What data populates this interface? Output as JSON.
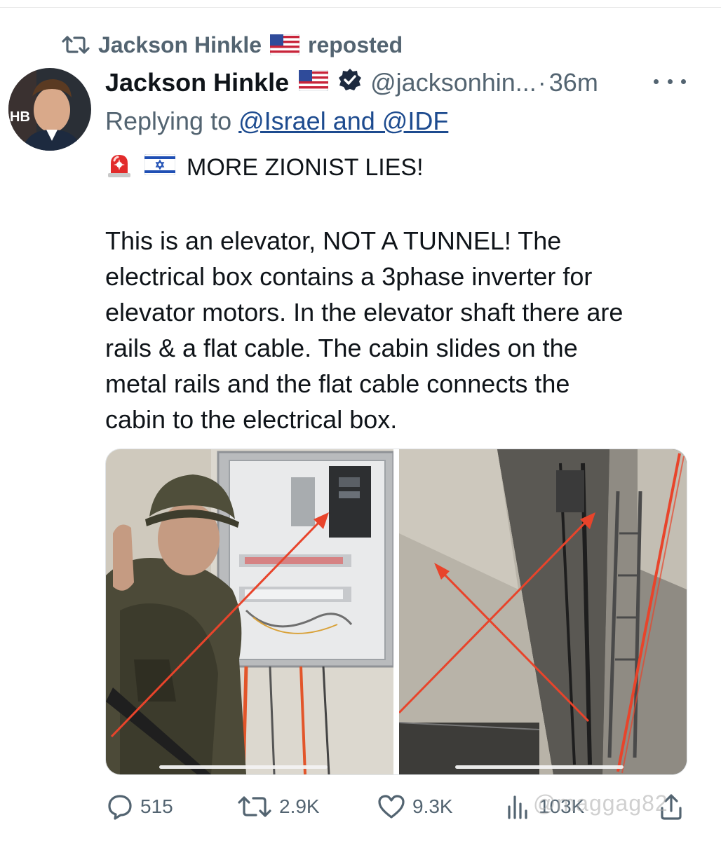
{
  "repost": {
    "user": "Jackson Hinkle",
    "flag_icon": "us-flag-emoji",
    "label": "reposted"
  },
  "tweet": {
    "name": "Jackson Hinkle",
    "flag_icon": "us-flag-emoji",
    "verified_icon": "verified-badge-icon",
    "handle": "@jacksonhin...",
    "separator": "·",
    "time": "36m",
    "replying_prefix": "Replying to",
    "replying_to": "@Israel and @IDF",
    "lead_emojis": [
      "police-light-emoji",
      "israel-flag-emoji"
    ],
    "lead_text": "MORE ZIONIST LIES!",
    "body": [
      "This is an elevator, NOT A TUNNEL! The",
      "electrical box contains a 3phase inverter for",
      "elevator motors. In the elevator shaft there are",
      "rails & a flat cable. The cabin slides on the",
      "metal rails and the flat cable connects the",
      "cabin to the electrical box."
    ]
  },
  "media": {
    "images": [
      {
        "description_icon": "soldier-electrical-box-photo"
      },
      {
        "description_icon": "elevator-shaft-photo"
      }
    ],
    "arrow_color": "#e8442b"
  },
  "actions": {
    "replies": "515",
    "reposts": "2.9K",
    "likes": "9.3K",
    "views": "103K"
  },
  "watermark": "@maggag82",
  "colors": {
    "text": "#0f1419",
    "muted": "#536471",
    "link": "#1d4b8f",
    "verified": "#1d9bf0"
  }
}
